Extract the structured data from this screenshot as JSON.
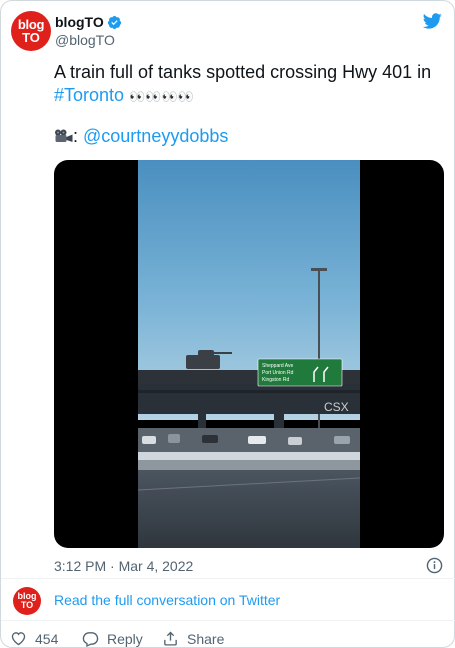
{
  "author": {
    "display_name": "blogTO",
    "handle": "@blogTO",
    "avatar_line1": "blog",
    "avatar_line2": "TO",
    "verified": true
  },
  "tweet": {
    "text_line1": "A train full of tanks spotted crossing Hwy 401 in",
    "hashtag": "#Toronto",
    "eyes": "👀👀👀👀",
    "camera_emoji_label": ": ",
    "mention": "@courtneyydobbs"
  },
  "media": {
    "sign_lines": [
      "Sheppard Ave",
      "Port Union Rd",
      "Kingston Rd"
    ],
    "rail_mark": "CSX"
  },
  "timestamp": "3:12 PM · Mar 4, 2022",
  "conversation": {
    "link_text": "Read the full conversation on Twitter"
  },
  "actions": {
    "like_count": "454",
    "reply_label": "Reply",
    "share_label": "Share"
  },
  "colors": {
    "brand_red": "#e0211b",
    "link_blue": "#1d9bf0",
    "muted_text": "#536471"
  }
}
